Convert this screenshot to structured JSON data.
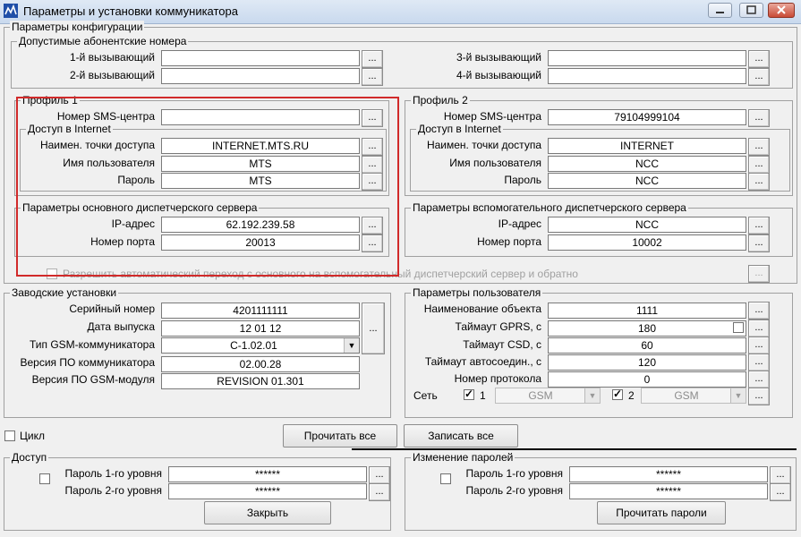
{
  "window": {
    "title": "Параметры и установки коммуникатора"
  },
  "config": {
    "group_label": "Параметры конфигурации",
    "allowed_numbers": {
      "label": "Допустимые абонентские номера",
      "caller1_label": "1-й вызывающий",
      "caller1_value": "",
      "caller2_label": "2-й вызывающий",
      "caller2_value": "",
      "caller3_label": "3-й вызывающий",
      "caller3_value": "",
      "caller4_label": "4-й вызывающий",
      "caller4_value": ""
    },
    "profile1": {
      "label": "Профиль 1",
      "sms_label": "Номер SMS-центра",
      "sms_value": "",
      "internet_label": "Доступ в Internet",
      "apn_label": "Наимен. точки доступа",
      "apn_value": "INTERNET.MTS.RU",
      "user_label": "Имя пользователя",
      "user_value": "MTS",
      "pass_label": "Пароль",
      "pass_value": "MTS"
    },
    "profile2": {
      "label": "Профиль 2",
      "sms_label": "Номер SMS-центра",
      "sms_value": "79104999104",
      "internet_label": "Доступ в Internet",
      "apn_label": "Наимен. точки доступа",
      "apn_value": "INTERNET",
      "user_label": "Имя пользователя",
      "user_value": "NCC",
      "pass_label": "Пароль",
      "pass_value": "NCC"
    },
    "main_server": {
      "label": "Параметры основного диспетчерского сервера",
      "ip_label": "IP-адрес",
      "ip_value": "62.192.239.58",
      "port_label": "Номер порта",
      "port_value": "20013"
    },
    "aux_server": {
      "label": "Параметры вспомогательного диспетчерского сервера",
      "ip_label": "IP-адрес",
      "ip_value": "NCC",
      "port_label": "Номер порта",
      "port_value": "10002"
    },
    "auto_switch_label": "Разрешить автоматический переход с основного на вспомогательный диспетчерский сервер и обратно"
  },
  "factory": {
    "label": "Заводские установки",
    "serial_label": "Серийный номер",
    "serial_value": "4201111111",
    "date_label": "Дата выпуска",
    "date_value": "12 01 12",
    "gsm_type_label": "Тип GSM-коммуникатора",
    "gsm_type_value": "C-1.02.01",
    "fw_label": "Версия ПО коммуникатора",
    "fw_value": "02.00.28",
    "gsm_fw_label": "Версия ПО GSM-модуля",
    "gsm_fw_value": "REVISION 01.301"
  },
  "user_params": {
    "label": "Параметры пользователя",
    "object_label": "Наименование объекта",
    "object_value": "1111",
    "gprs_label": "Таймаут GPRS, с",
    "gprs_value": "180",
    "csd_label": "Таймаут CSD, с",
    "csd_value": "60",
    "autoconn_label": "Таймаут автосоедин., с",
    "autoconn_value": "120",
    "protocol_label": "Номер протокола",
    "protocol_value": "0",
    "network_label": "Сеть",
    "net1_num": "1",
    "net1_value": "GSM",
    "net2_num": "2",
    "net2_value": "GSM"
  },
  "actions": {
    "cycle_label": "Цикл",
    "read_all": "Прочитать все",
    "write_all": "Записать все"
  },
  "access": {
    "label": "Доступ",
    "level1_label": "Пароль 1-го уровня",
    "level1_value": "******",
    "level2_label": "Пароль 2-го уровня",
    "level2_value": "******",
    "close_button": "Закрыть"
  },
  "change_passwords": {
    "label": "Изменение паролей",
    "level1_label": "Пароль 1-го уровня",
    "level1_value": "******",
    "level2_label": "Пароль 2-го уровня",
    "level2_value": "******",
    "read_button": "Прочитать пароли"
  },
  "dots_label": "...",
  "icons": {
    "app": "app-icon",
    "dropdown": "chevron-down-icon"
  },
  "colors": {
    "highlight": "#d12a2a"
  }
}
